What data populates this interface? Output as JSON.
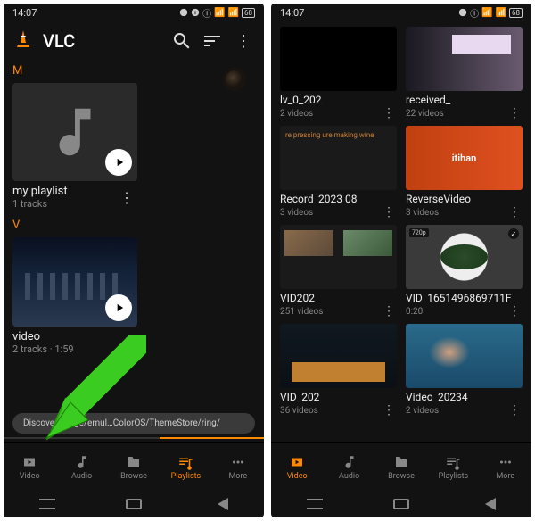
{
  "statusbar": {
    "time": "14:07",
    "battery": "68"
  },
  "left": {
    "app_name": "VLC",
    "sections": {
      "m": {
        "letter": "M",
        "playlist": {
          "title": "my playlist",
          "subtitle": "1 tracks"
        }
      },
      "v": {
        "letter": "V",
        "playlist": {
          "title": "video",
          "subtitle": "2 tracks · 1:59"
        }
      }
    },
    "snackbar": "Discovering    ige/emul…ColorOS/ThemeStore/ring/"
  },
  "right": {
    "items": [
      {
        "title": "lv_0_202",
        "sub": "2 videos"
      },
      {
        "title": "received_",
        "sub": "22 videos"
      },
      {
        "title": "Record_2023 08",
        "sub": "3 videos"
      },
      {
        "title": "ReverseVideo",
        "sub": "3 videos"
      },
      {
        "title": "VID202",
        "sub": "251 videos"
      },
      {
        "title": "VID_1651496869711F",
        "sub": "0:20"
      },
      {
        "title": "VID_202",
        "sub": "36 videos"
      },
      {
        "title": "Video_20234",
        "sub": "2 videos"
      }
    ],
    "badge720": "720p",
    "orange_text": "itihan",
    "press_text": "re pressing\nure making\nwine"
  },
  "nav": {
    "video": "Video",
    "audio": "Audio",
    "browse": "Browse",
    "playlists": "Playlists",
    "more": "More"
  }
}
